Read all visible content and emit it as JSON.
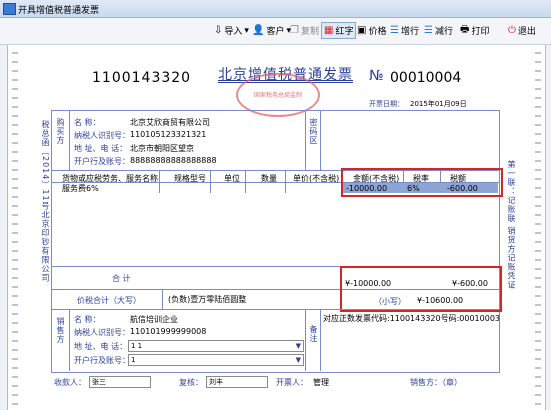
{
  "window": {
    "title": "开具增值税普通发票"
  },
  "toolbar": {
    "import": "导入",
    "customer": "客户",
    "copy": "复制",
    "red": "红字",
    "price": "价格",
    "add": "增行",
    "remove": "减行",
    "print": "打印",
    "exit": "退出"
  },
  "invoice": {
    "code": "1100143320",
    "title": "北京增值税普通发票",
    "no_prefix": "№",
    "number": "00010004",
    "date_label": "开票日期：",
    "date": "2015年01月09日",
    "stamp": "国家税务总局监制",
    "left_vertical": "税总函〔2014〕11号北京印钞有限公司",
    "right_vertical": "第一联：记账联  销货方记账凭证",
    "buyer": {
      "side_label": "购买方",
      "name_label": "名    称：",
      "name": "北京艾欣商贸有限公司",
      "tax_label": "纳税人识别号：",
      "tax": "110105123321321",
      "addr_label": "地 址、电 话：",
      "addr": "北京市朝阳区望京",
      "bank_label": "开户行及账号：",
      "bank": "88888888888888888"
    },
    "password_label": "密码区",
    "table": {
      "headers": [
        "货物或应税劳务、服务名称",
        "规格型号",
        "单位",
        "数量",
        "单价(不含税)",
        "金额(不含税)",
        "税率",
        "税额"
      ],
      "rows": [
        {
          "name": "服务费6%",
          "spec": "",
          "unit": "",
          "qty": "",
          "price": "",
          "amount": "-10000.00",
          "rate": "6%",
          "tax": "-600.00"
        }
      ]
    },
    "total": {
      "label": "合        计",
      "amount": "¥-10000.00",
      "tax": "¥-600.00"
    },
    "sum": {
      "label": "价税合计（大写）",
      "text": "(负数)壹万零陆佰圆整",
      "small_label": "（小写）",
      "small": "¥-10600.00"
    },
    "seller": {
      "side_label": "销售方",
      "name_label": "名    称：",
      "name": "航信培训企业",
      "tax_label": "纳税人识别号：",
      "tax": "110101999999008",
      "addr_label": "地 址、电 话：",
      "addr": "1 1",
      "bank_label": "开户行及账号：",
      "bank": "1"
    },
    "remark_label": "备注",
    "remark": "对应正数发票代码:1100143320号码:00010003",
    "payee_label": "收款人：",
    "payee": "张三",
    "reviewer_label": "复核：",
    "reviewer": "刘丰",
    "drawer_label": "开票人：",
    "drawer": "管理",
    "seller_sign": "销售方：（章）"
  }
}
